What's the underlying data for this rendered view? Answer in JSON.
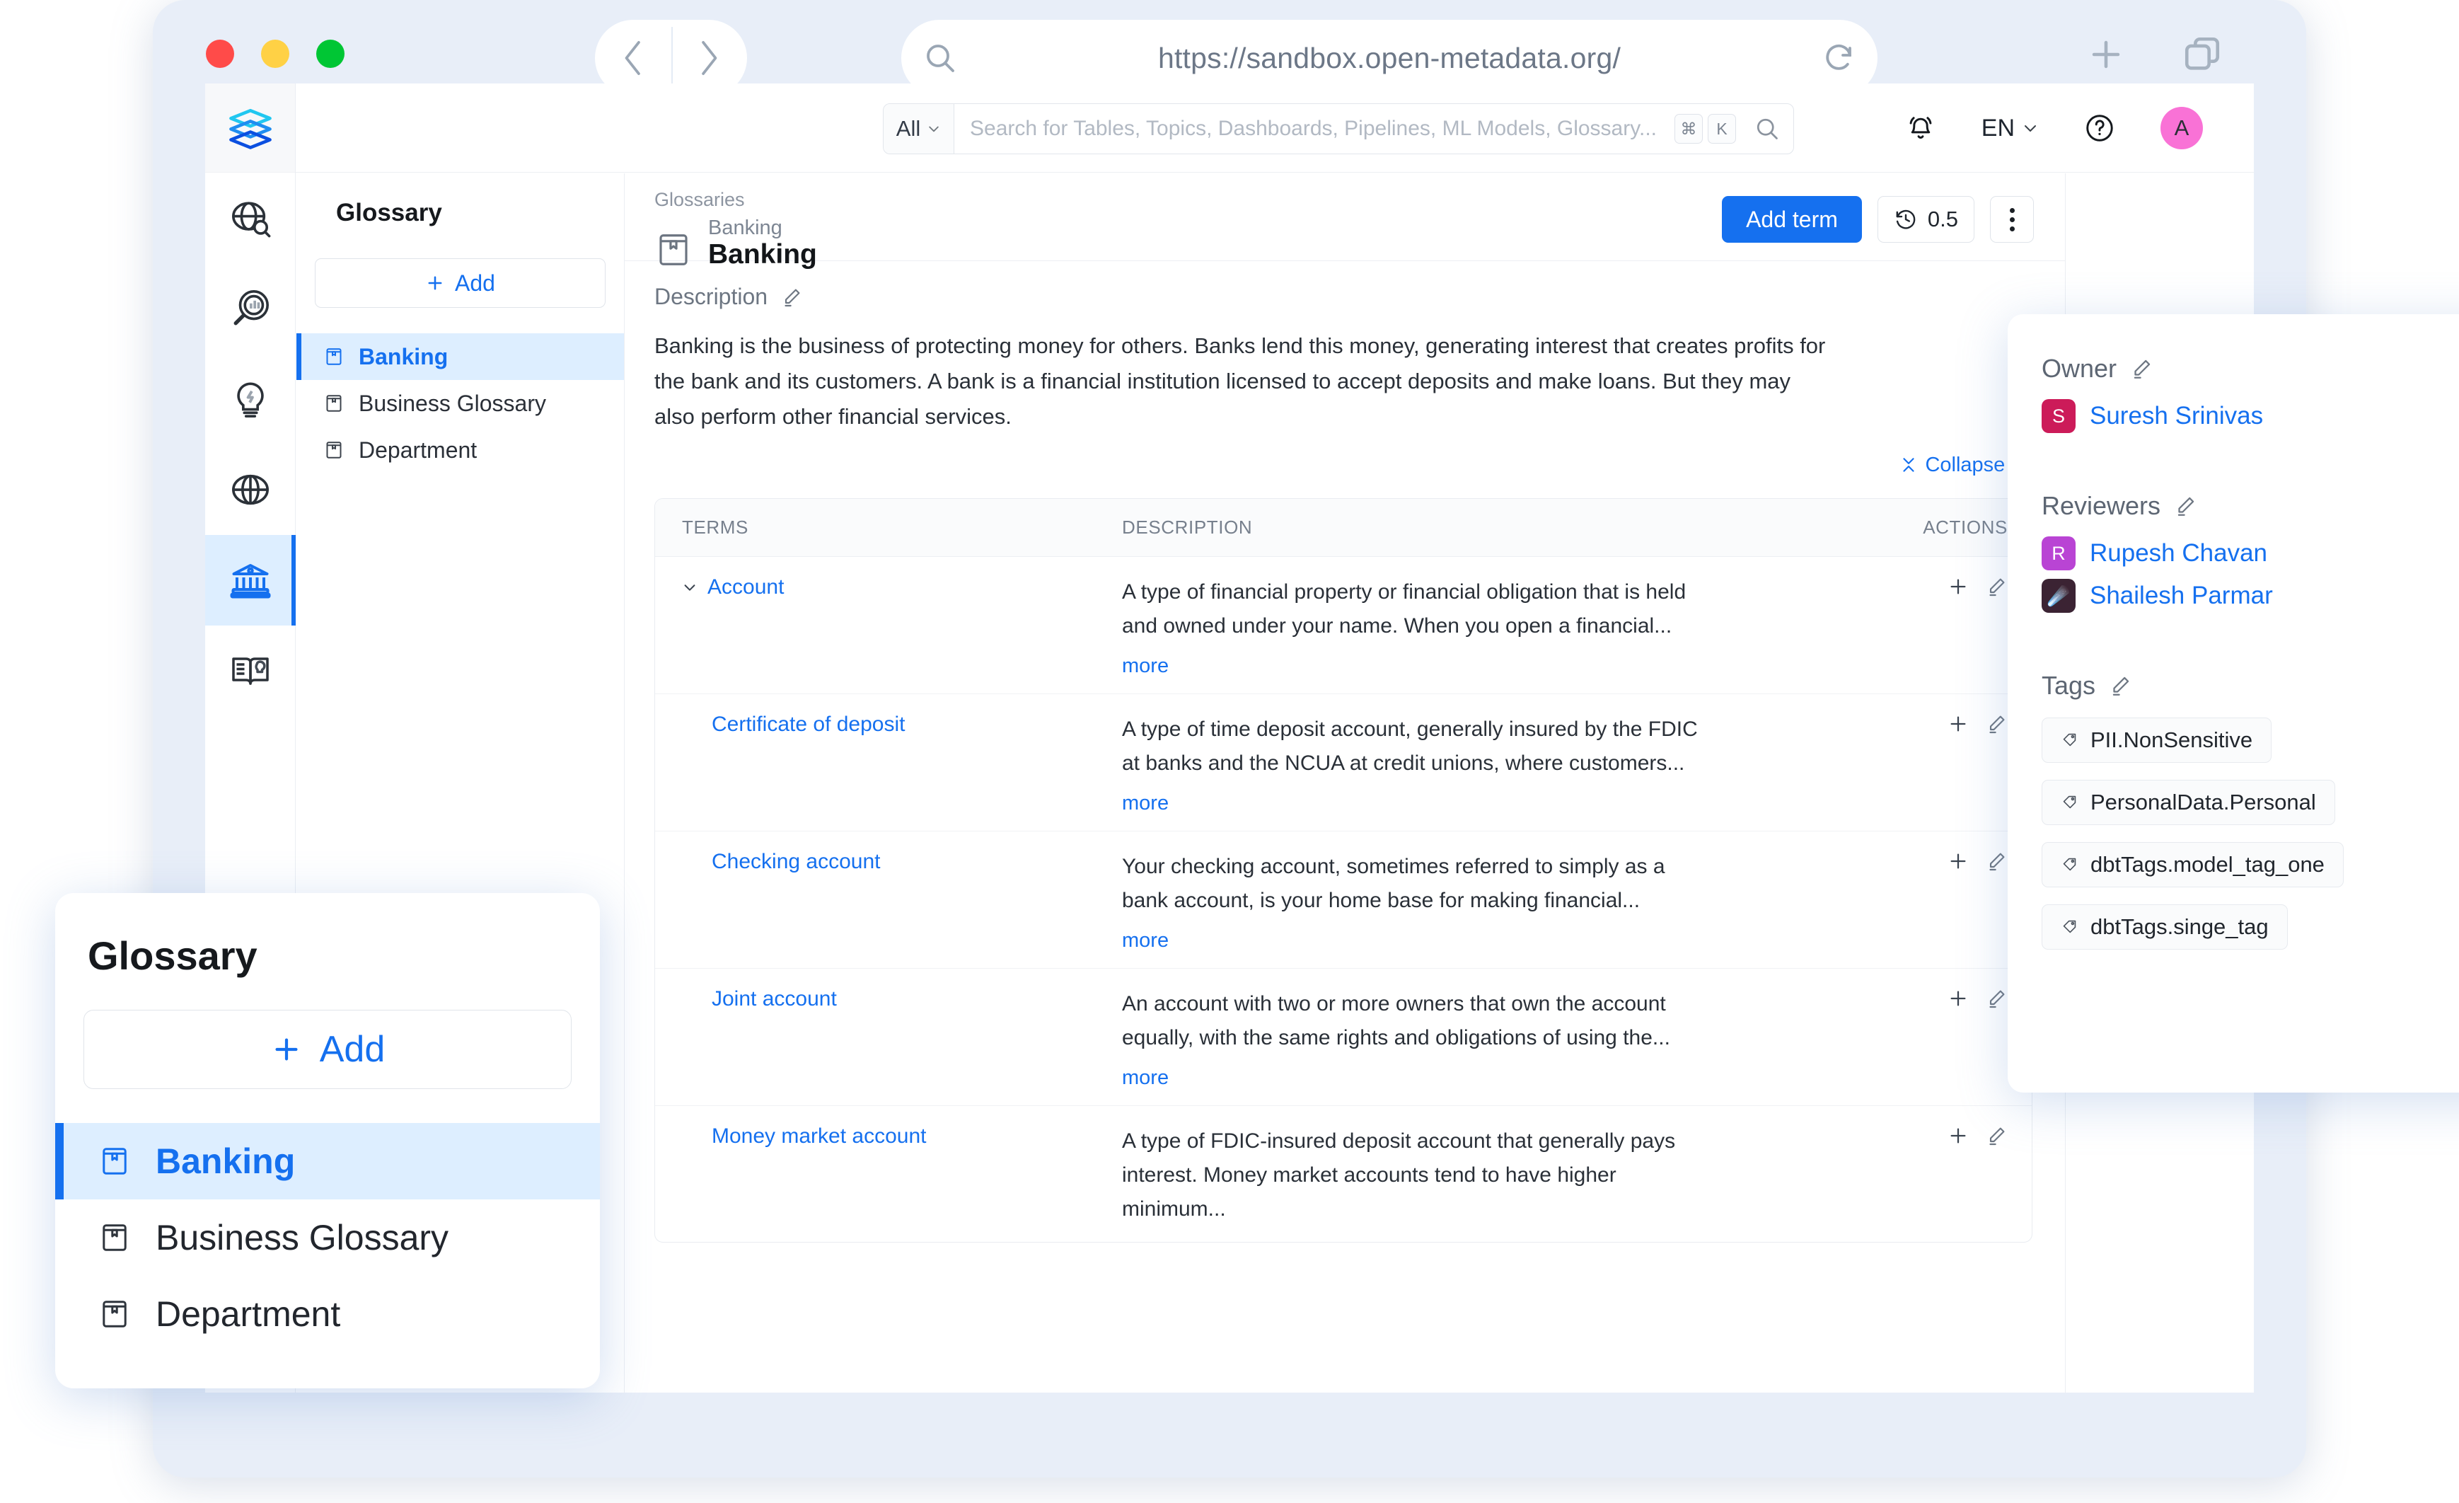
{
  "browser": {
    "url": "https://sandbox.open-metadata.org/",
    "back_icon": "chevron-left-icon",
    "forward_icon": "chevron-right-icon",
    "reload_icon": "reload-icon",
    "url_search_icon": "search-icon",
    "new_tab_icon": "plus-icon",
    "tabs_overview_icon": "copy-tabs-icon"
  },
  "app_bar": {
    "search": {
      "scope": "All",
      "placeholder": "Search for Tables, Topics, Dashboards, Pipelines, ML Models, Glossary...",
      "value": "",
      "kbd_cmd": "⌘",
      "kbd_key": "K"
    },
    "notifications_icon": "bell-icon",
    "language": "EN",
    "help_icon": "help-circle-icon",
    "avatar_initial": "A",
    "avatar_color": "#f972d6"
  },
  "rail": {
    "logo_icon": "openmetadata-logo-icon",
    "items": [
      {
        "icon": "explore-globe-search-icon",
        "active": false
      },
      {
        "icon": "data-quality-magnifier-icon",
        "active": false
      },
      {
        "icon": "insights-bulb-icon",
        "active": false
      },
      {
        "icon": "globe-icon",
        "active": false
      },
      {
        "icon": "govern-bank-icon",
        "active": true
      },
      {
        "icon": "glossary-book-icon",
        "active": false
      }
    ]
  },
  "glossary_panel": {
    "title": "Glossary",
    "add_label": "Add",
    "items": [
      {
        "label": "Banking",
        "active": true
      },
      {
        "label": "Business Glossary",
        "active": false
      },
      {
        "label": "Department",
        "active": false
      }
    ]
  },
  "main": {
    "breadcrumb": "Glossaries",
    "entity_type": "Banking",
    "entity_name": "Banking",
    "entity_icon": "glossary-book-icon",
    "actions": {
      "add_term": "Add term",
      "version": "0.5",
      "version_icon": "history-clock-icon",
      "more_icon": "more-vertical-icon"
    },
    "description": {
      "label": "Description",
      "edit_icon": "pencil-edit-icon",
      "text": "Banking is the business of protecting money for others. Banks lend this money, generating interest that creates profits for the bank and its customers. A bank is a financial institution licensed to accept deposits and make loans. But they may also perform other financial services."
    },
    "collapse_all": "Collapse All",
    "collapse_icon": "collapse-icon",
    "table": {
      "columns": [
        "TERMS",
        "DESCRIPTION",
        "ACTIONS"
      ],
      "more_label": "more",
      "add_icon": "plus-icon",
      "edit_icon": "pencil-edit-icon",
      "rows": [
        {
          "term": "Account",
          "expandable": true,
          "indent": false,
          "description": "A type of financial property or financial obligation that is held and owned under your name. When you open a financial...",
          "has_more": true
        },
        {
          "term": "Certificate of deposit",
          "expandable": false,
          "indent": true,
          "description": "A type of time deposit account, generally insured by the FDIC at banks and the NCUA at credit unions, where customers...",
          "has_more": true
        },
        {
          "term": "Checking account",
          "expandable": false,
          "indent": true,
          "description": "Your checking account, sometimes referred to simply as a bank account, is your home base for making financial...",
          "has_more": true
        },
        {
          "term": "Joint account",
          "expandable": false,
          "indent": true,
          "description": "An account with two or more owners that own the account equally, with the same rights and obligations of using the...",
          "has_more": true
        },
        {
          "term": "Money market account",
          "expandable": false,
          "indent": true,
          "description": "A type of FDIC-insured deposit account that generally pays interest. Money market accounts tend to have higher minimum...",
          "has_more": false
        }
      ]
    }
  },
  "right_panel": {
    "owner": {
      "label": "Owner",
      "edit_icon": "pencil-edit-icon",
      "name": "Suresh Srinivas",
      "initial": "S",
      "color": "#cc1b59"
    },
    "reviewers": {
      "label": "Reviewers",
      "edit_icon": "pencil-edit-icon",
      "people": [
        {
          "name": "Rupesh Chavan",
          "initial": "R",
          "color": "#b944d4",
          "emoji": ""
        },
        {
          "name": "Shailesh Parmar",
          "initial": "",
          "color": "#3b2333",
          "emoji": "☄️"
        }
      ]
    },
    "tags": {
      "label": "Tags",
      "edit_icon": "pencil-edit-icon",
      "tag_icon": "tag-icon",
      "items": [
        "PII.NonSensitive",
        "PersonalData.Personal",
        "dbtTags.model_tag_one",
        "dbtTags.singe_tag"
      ]
    }
  },
  "zoom_callout": {
    "title": "Glossary",
    "add_label": "Add",
    "items": [
      {
        "label": "Banking",
        "active": true
      },
      {
        "label": "Business Glossary",
        "active": false
      },
      {
        "label": "Department",
        "active": false
      }
    ]
  }
}
